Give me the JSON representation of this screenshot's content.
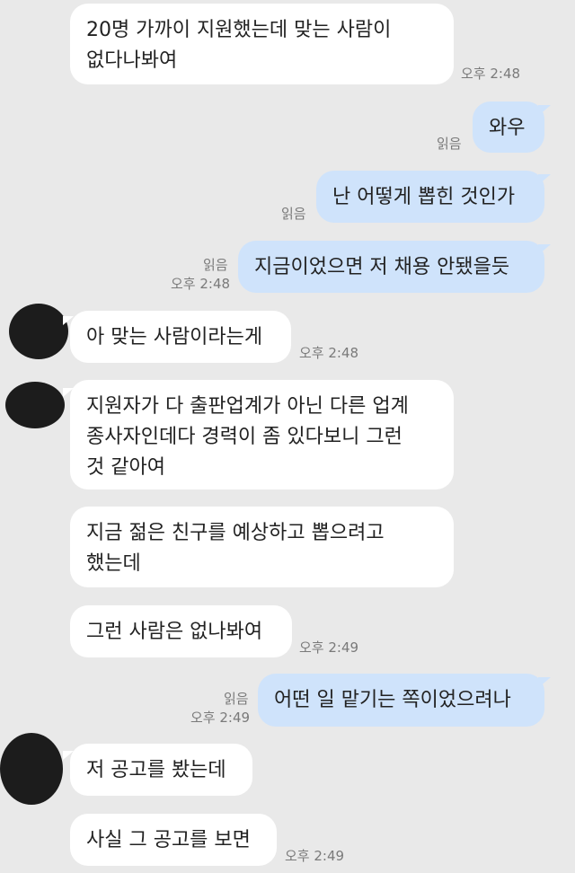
{
  "messages": [
    {
      "text": "20명 가까이 지원했는데 맞는 사람이\n없다나봐여",
      "time": "오후 2:48"
    },
    {
      "text": "와우",
      "read": "읽음"
    },
    {
      "text": "난 어떻게 뽑힌 것인가",
      "read": "읽음"
    },
    {
      "text": "지금이었으면 저 채용 안됐을듯",
      "read": "읽음",
      "time": "오후 2:48"
    },
    {
      "text": "아 맞는 사람이라는게",
      "time": "오후 2:48"
    },
    {
      "text": "지원자가 다 출판업계가 아닌 다른 업계\n종사자인데다 경력이 좀 있다보니 그런\n것 같아여"
    },
    {
      "text": "지금 젊은 친구를 예상하고 뽑으려고\n했는데"
    },
    {
      "text": "그런 사람은 없나봐여",
      "time": "오후 2:49"
    },
    {
      "text": "어떤 일 맡기는 쪽이었으려나",
      "read": "읽음",
      "time": "오후 2:49"
    },
    {
      "text": "저 공고를 봤는데"
    },
    {
      "text": "사실 그 공고를 보면",
      "time": "오후 2:49"
    }
  ]
}
